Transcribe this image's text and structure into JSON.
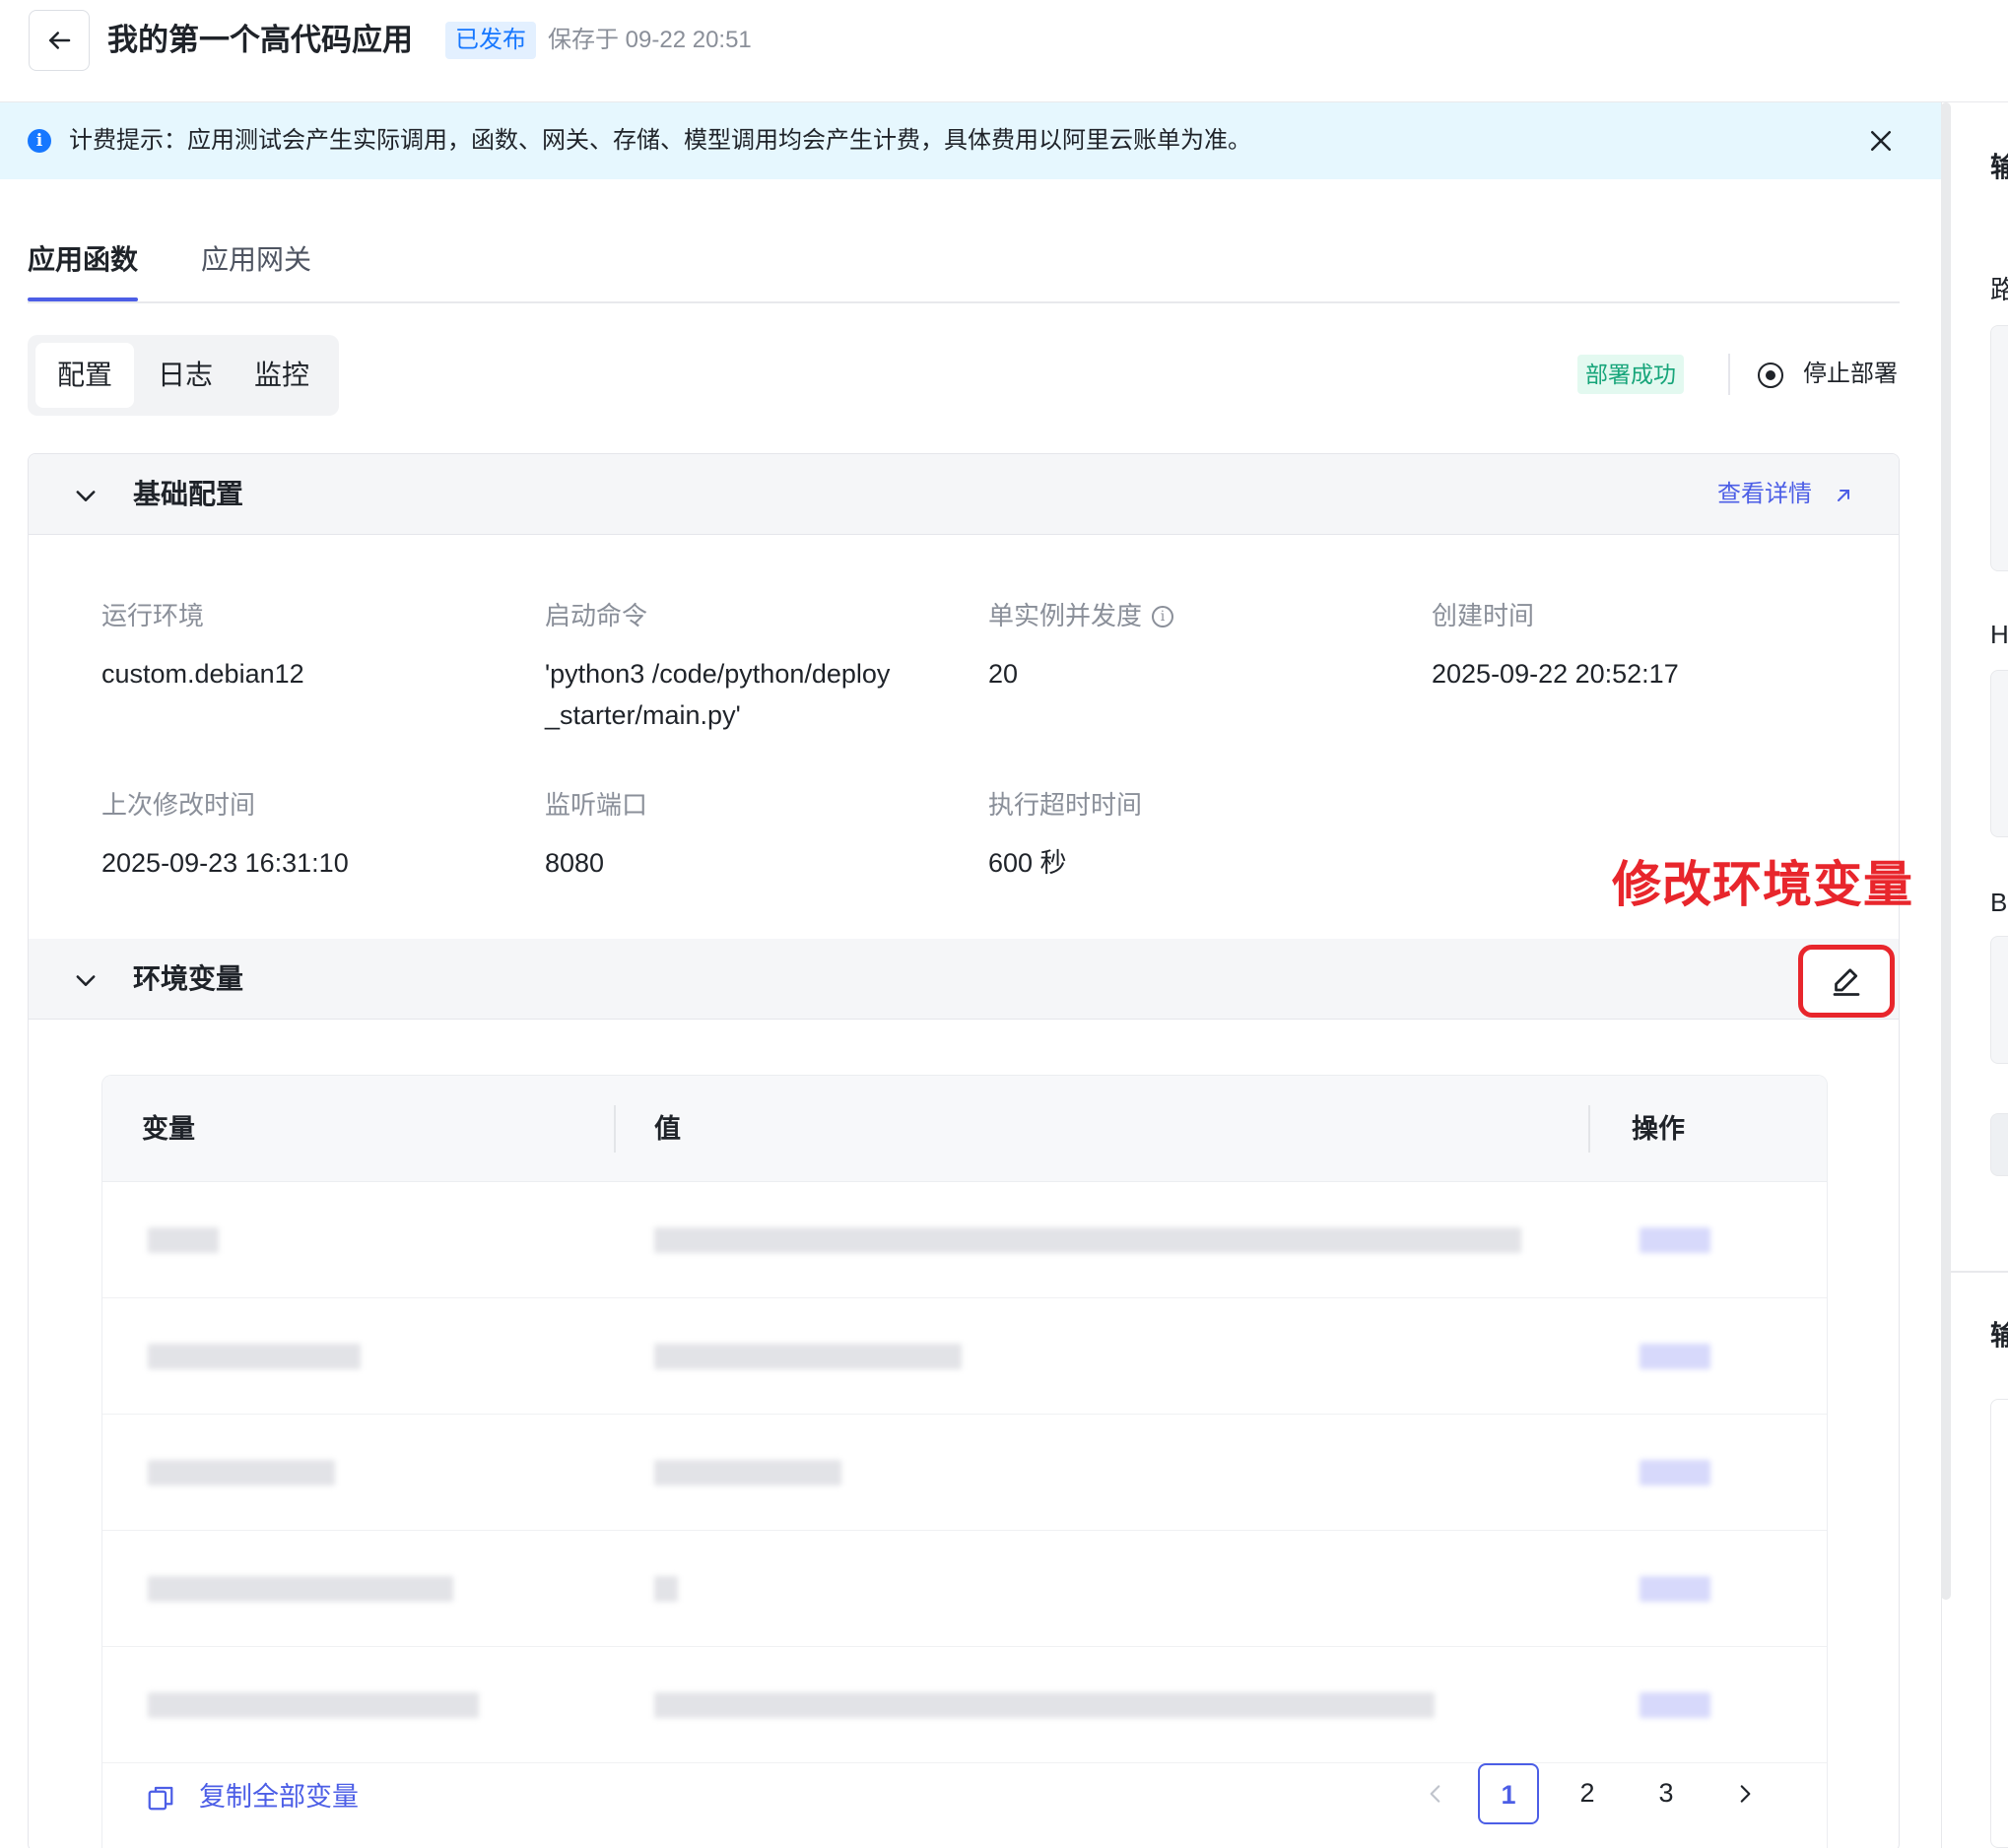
{
  "header": {
    "title": "我的第一个高代码应用",
    "status_badge": "已发布",
    "saved_at": "保存于 09-22 20:51"
  },
  "notice": {
    "text": "计费提示：应用测试会产生实际调用，函数、网关、存储、模型调用均会产生计费，具体费用以阿里云账单为准。"
  },
  "tabs": [
    {
      "label": "应用函数",
      "active": true
    },
    {
      "label": "应用网关",
      "active": false
    }
  ],
  "segments": [
    {
      "label": "配置",
      "active": true
    },
    {
      "label": "日志",
      "active": false
    },
    {
      "label": "监控",
      "active": false
    }
  ],
  "deploy": {
    "status": "部署成功",
    "stop_label": "停止部署"
  },
  "basic_config": {
    "title": "基础配置",
    "detail_link": "查看详情",
    "fields": [
      {
        "label": "运行环境",
        "value": "custom.debian12"
      },
      {
        "label": "启动命令",
        "value": "'python3 /code/python/deploy_starter/main.py'"
      },
      {
        "label": "单实例并发度",
        "value": "20"
      },
      {
        "label": "创建时间",
        "value": "2025-09-22 20:52:17"
      },
      {
        "label": "上次修改时间",
        "value": "2025-09-23 16:31:10"
      },
      {
        "label": "监听端口",
        "value": "8080"
      },
      {
        "label": "执行超时时间",
        "value": "600 秒"
      }
    ]
  },
  "annotation": "修改环境变量",
  "env_vars": {
    "title": "环境变量",
    "columns": [
      "变量",
      "值",
      "操作"
    ],
    "copy_all": "复制全部变量",
    "pagination": {
      "pages": [
        "1",
        "2",
        "3"
      ],
      "current": "1"
    }
  },
  "right_panel": {
    "labels": [
      "输",
      "路",
      "H",
      "Bo",
      "输"
    ]
  },
  "colors": {
    "accent": "#4c5ee6",
    "success": "#17a57a",
    "danger": "#e8262c",
    "info": "#1677ff"
  }
}
